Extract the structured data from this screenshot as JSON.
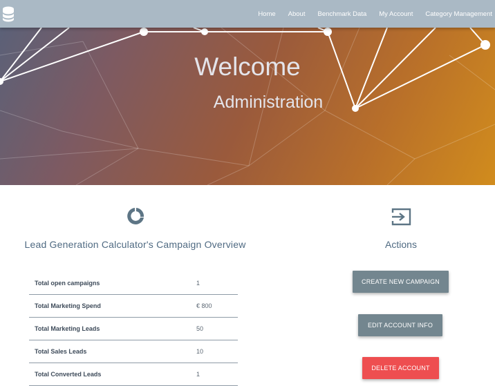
{
  "navbar": {
    "brand_icon": "database-icon",
    "links": [
      "Home",
      "About",
      "Benchmark Data",
      "My Account",
      "Category Management"
    ]
  },
  "hero": {
    "title": "Welcome",
    "subtitle": "Administration"
  },
  "overview": {
    "icon": "donut-chart-icon",
    "title": "Lead Generation Calculator's Campaign Overview",
    "rows": [
      {
        "label": "Total open campaigns",
        "value": "1"
      },
      {
        "label": "Total Marketing Spend",
        "value": "€ 800"
      },
      {
        "label": "Total Marketing Leads",
        "value": "50"
      },
      {
        "label": "Total Sales Leads",
        "value": "10"
      },
      {
        "label": "Total Converted Leads",
        "value": "1"
      }
    ]
  },
  "actions": {
    "icon": "sign-in-icon",
    "title": "Actions",
    "create_label": "CREATE NEW CAMPAIGN",
    "edit_label": "EDIT ACCOUNT INFO",
    "delete_label": "DELETE ACCOUNT"
  },
  "colors": {
    "navbar": "#aab9c5",
    "heading": "#4f6a82",
    "button": "#73868f",
    "danger": "#ee4e50"
  }
}
